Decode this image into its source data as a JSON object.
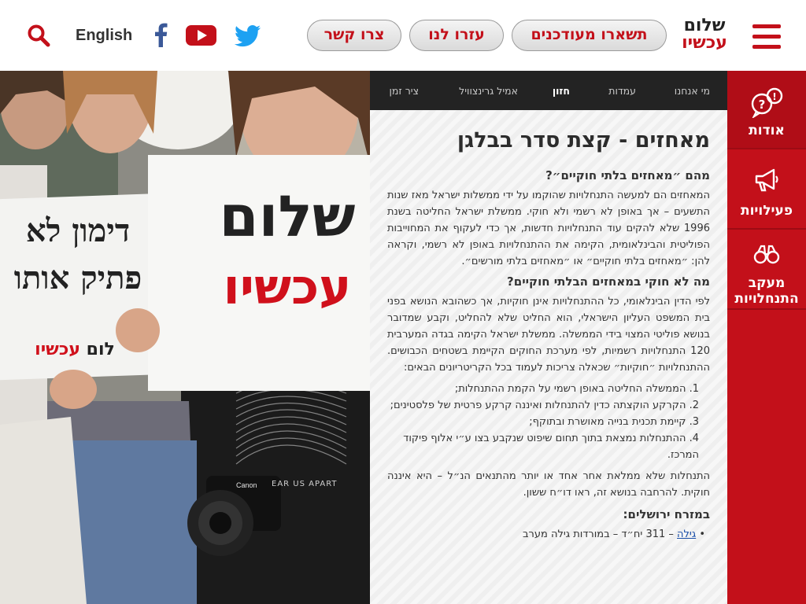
{
  "header": {
    "logo": {
      "line1": "שלום",
      "line2": "עכשיו"
    },
    "buttons": {
      "stay_updated": "תשארו מעודכנים",
      "help_us": "עזרו לנו",
      "contact": "צרו קשר"
    },
    "language": "English",
    "social_icons": [
      "twitter-icon",
      "youtube-icon",
      "facebook-icon"
    ],
    "accent_color": "#c3101a"
  },
  "photo": {
    "sign_right": {
      "line1": "שלום",
      "line2": "עכשיו"
    },
    "sign_left": {
      "line1": "דימון לא",
      "line2": "פתיק אותו",
      "footer_black": "לום",
      "footer_red": "עכשיו"
    },
    "shirt_text": "EAR US APART",
    "camera_brand": "Canon"
  },
  "subnav": {
    "items": [
      "מי אנחנו",
      "עמדות",
      "חזון",
      "אמיל גרינצוויל",
      "ציר זמן"
    ],
    "active_index": 2
  },
  "content": {
    "title": "מאחזים - קצת סדר בבלגן",
    "section1_heading": "מהם ״מאחזים בלתי חוקיים״?",
    "section1_text": "המאחזים הם למעשה התנחלויות שהוקמו על ידי ממשלות ישראל מאז שנות התשעים – אך באופן לא רשמי ולא חוקי. ממשלת ישראל החליטה בשנת 1996 שלא להקים עוד התנחלויות חדשות, אך כדי לעקוף את המחוייבות הפוליטית והבינלאומית, הקימה את ההתנחלויות באופן לא רשמי, וקראה להן: ״מאחזים בלתי חוקיים״ או ״מאחזים בלתי מורשים״.",
    "section2_heading": "מה לא חוקי במאחזים הבלתי חוקיים?",
    "section2_text": "לפי הדין הבינלאומי, כל ההתנחלויות אינן חוקיות, אך כשהובא הנושא בפני בית המשפט העליון הישראלי, הוא החליט שלא להחליט, וקבע שמדובר בנושא פוליטי המצוי בידי הממשלה. ממשלת ישראל הקימה בגדה המערבית 120 התנחלויות רשמיות, לפי מערכת החוקים הקיימת בשטחים הכבושים. ההתנחלויות ״חוקיות״ שכאלה צריכות לעמוד בכל הקריטריונים הבאים:",
    "criteria": [
      "1. הממשלה החליטה באופן רשמי על הקמת ההתנחלות;",
      "2. הקרקע הוקצתה כדין להתנחלות ואיננה קרקע פרטית של פלסטינים;",
      "3. קיימת תכנית בנייה מאושרת ובתוקף;",
      "4. ההתנחלות נמצאת בתוך תחום שיפוט שנקבע בצו ע״י אלוף פיקוד המרכז."
    ],
    "section3_text": "התנחלות שלא ממלאת אחר אחד או יותר מהתנאים הנ״ל – היא איננה חוקית. להרחבה בנושא זה, ראו דו״ח ששון.",
    "section4_heading": "במזרח ירושלים:",
    "bullet_link": "גילה",
    "bullet_text": " – 311 יח״ד – במורדות גילה מערב"
  },
  "sidebar": {
    "items": [
      {
        "label": "אודות",
        "icon": "speech-bubble-question-icon"
      },
      {
        "label": "פעילויות",
        "icon": "megaphone-icon"
      },
      {
        "label_line1": "מעקב",
        "label_line2": "התנחלויות",
        "icon": "binoculars-icon"
      }
    ]
  }
}
